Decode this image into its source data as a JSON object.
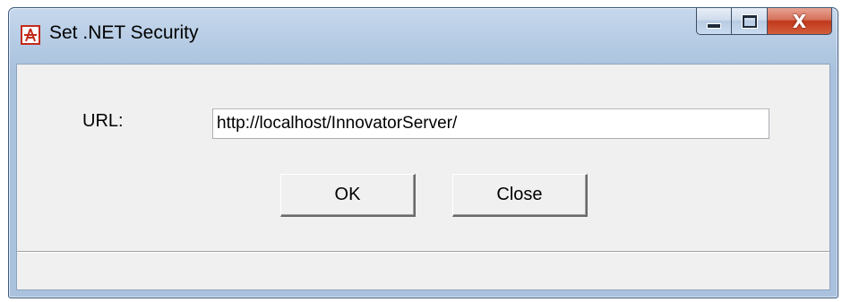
{
  "window": {
    "title": "Set .NET Security",
    "app_icon": "aras-app-icon",
    "controls": {
      "minimize_icon": "minimize-icon",
      "maximize_icon": "maximize-icon",
      "close_glyph": "X"
    }
  },
  "form": {
    "url_label": "URL:",
    "url_value": "http://localhost/InnovatorServer/"
  },
  "buttons": {
    "ok_label": "OK",
    "close_label": "Close"
  },
  "colors": {
    "frame": "#aac2de",
    "close_button": "#c0391c",
    "client": "#f0f0f0"
  }
}
